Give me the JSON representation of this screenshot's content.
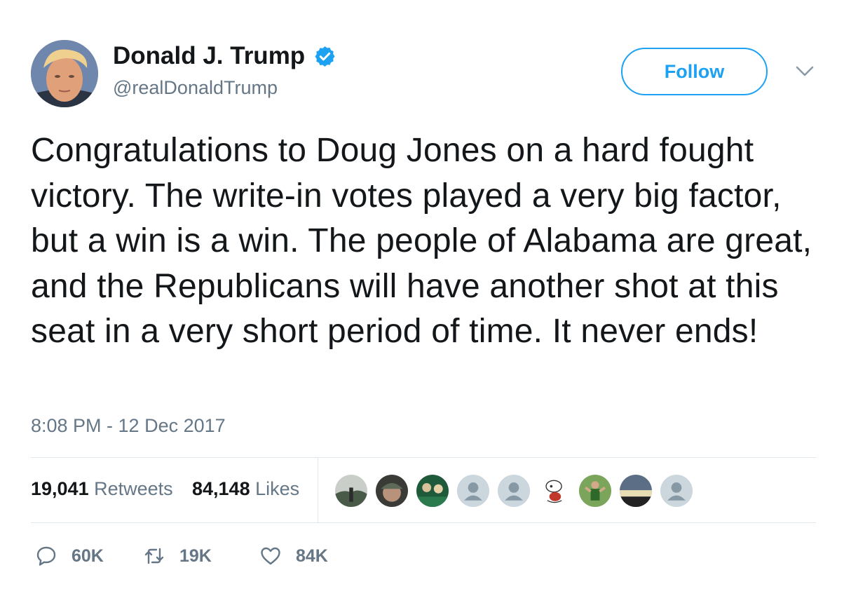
{
  "author": {
    "display_name": "Donald J. Trump",
    "handle": "@realDonaldTrump",
    "verified": true
  },
  "header": {
    "follow_label": "Follow"
  },
  "tweet": {
    "text": "Congratulations to Doug Jones on a hard fought victory. The write-in votes played a very big factor, but a win is a win. The people of Alabama are great, and the Republicans will have another shot at this seat in a very short period of time. It never ends!",
    "timestamp": "8:08 PM - 12 Dec 2017"
  },
  "stats": {
    "retweets_count": "19,041",
    "retweets_label": "Retweets",
    "likes_count": "84,148",
    "likes_label": "Likes"
  },
  "actions": {
    "reply_count": "60K",
    "retweet_count": "19K",
    "like_count": "84K"
  },
  "colors": {
    "accent": "#1da1f2",
    "text": "#14171a",
    "muted": "#657786",
    "divider": "#e1e8ed"
  }
}
